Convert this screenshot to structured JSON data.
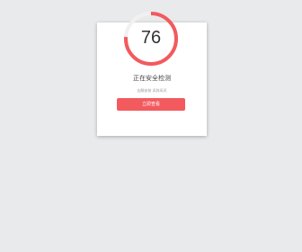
{
  "security_check": {
    "score": "76",
    "score_value": 76,
    "title": "正在安全检测",
    "subtitle": "去解安装 风阵风讯",
    "button_label": "立即查看",
    "colors": {
      "accent": "#f25a5e",
      "track": "#f1f1f1",
      "background": "#e8eaec",
      "card": "#ffffff"
    }
  }
}
